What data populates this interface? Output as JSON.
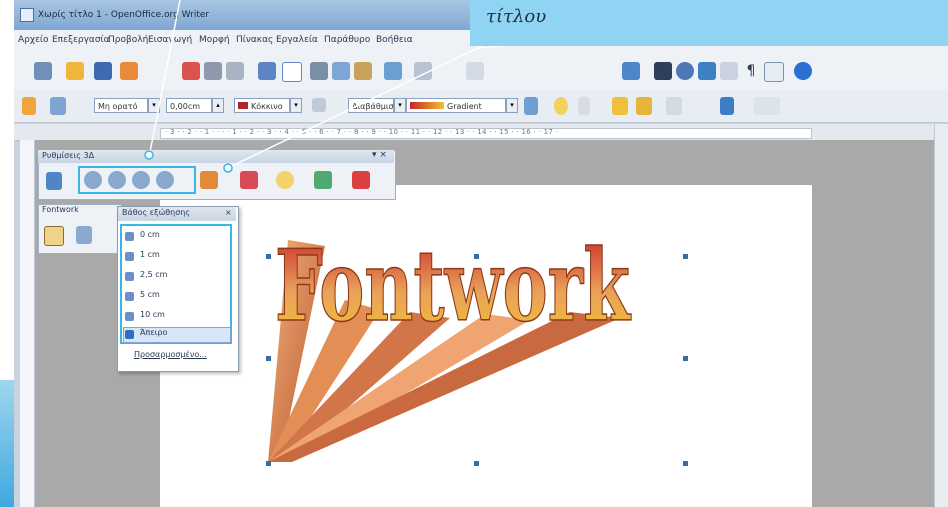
{
  "window": {
    "title": "Χωρίς τίτλο 1 - OpenOffice.org Writer"
  },
  "menu": [
    "Αρχείο",
    "Επεξεργασία",
    "Προβολή",
    "Εισαγωγή",
    "Μορφή",
    "Πίνακας",
    "Εργαλεία",
    "Παράθυρο",
    "Βοήθεια"
  ],
  "toolbar2": {
    "line_style": "Μη ορατό",
    "line_width": "0,00cm",
    "line_color": "Κόκκινο",
    "area_style": "Διαβάθμιση",
    "gradient": "Gradient"
  },
  "ruler_text": "· 3 · · 2 · · 1 · · · · 1 · · 2 · · 3 · · 4 · · 5 · · 6 · · 7 · · 8 · · 9 · · 10 · · 11 · · 12 · · 13 · · 14 · · 15 · · 16 · · 17 ·",
  "toolbar_3d": {
    "title": "Ρυθμίσεις 3Δ",
    "close": "▾ ×"
  },
  "toolbar_fontwork": {
    "title": "Fontwork"
  },
  "depth_popup": {
    "title": "Βάθος εξώθησης",
    "close": "×",
    "items": [
      "0 cm",
      "1 cm",
      "2,5 cm",
      "5 cm",
      "10 cm",
      "Άπειρο",
      "Προσαρμοσμένο..."
    ],
    "selected_index": 5
  },
  "callout": {
    "text": "τίτλου"
  },
  "fontwork_text": "Fontwork",
  "colors": {
    "callout": "#8fd4f2",
    "highlight_border": "#3ab6e6",
    "fontwork_fill": "#e9a15a",
    "fontwork_shadow": "#b8532b"
  }
}
